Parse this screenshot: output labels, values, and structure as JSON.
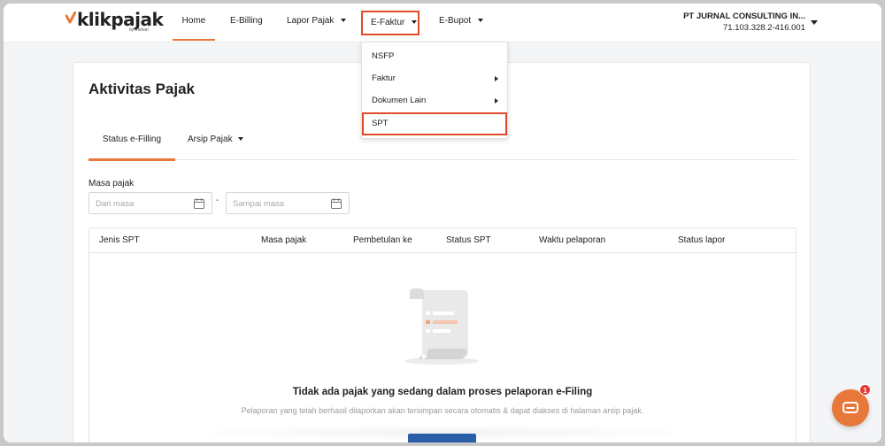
{
  "brand": {
    "logo_text": "klikpajak",
    "logo_sub": "by mekari",
    "accent": "#e8773a",
    "highlight": "#e04b2a"
  },
  "nav": {
    "items": [
      {
        "label": "Home",
        "active": true
      },
      {
        "label": "E-Billing"
      },
      {
        "label": "Lapor Pajak",
        "has_caret": true
      },
      {
        "label": "E-Faktur",
        "has_caret": true,
        "open": true
      },
      {
        "label": "E-Bupot",
        "has_caret": true
      }
    ]
  },
  "company": {
    "name": "PT JURNAL CONSULTING IN...",
    "npwp": "71.103.328.2-416.001"
  },
  "dropdown": {
    "items": [
      {
        "label": "NSFP"
      },
      {
        "label": "Faktur",
        "submenu": true
      },
      {
        "label": "Dokumen Lain",
        "submenu": true
      },
      {
        "label": "SPT",
        "highlighted": true
      }
    ]
  },
  "page": {
    "title": "Aktivitas Pajak",
    "tabs": [
      {
        "label": "Status e-Filling",
        "active": true
      },
      {
        "label": "Arsip Pajak",
        "has_caret": true
      }
    ],
    "filter": {
      "label": "Masa pajak",
      "from_placeholder": "Dari masa",
      "to_placeholder": "Sampai masa",
      "separator": "-"
    },
    "table": {
      "columns": [
        "Jenis SPT",
        "Masa pajak",
        "Pembetulan ke",
        "Status SPT",
        "Waktu pelaporan",
        "Status lapor"
      ],
      "empty_title": "Tidak ada pajak yang sedang dalam proses pelaporan e-Filing",
      "empty_desc": "Pelaporan yang telah berhasil dilaporkan akan tersimpan secara otomatis & dapat diakses di halaman arsip pajak."
    }
  },
  "chat": {
    "badge_count": "1",
    "icon": "chat-icon"
  }
}
